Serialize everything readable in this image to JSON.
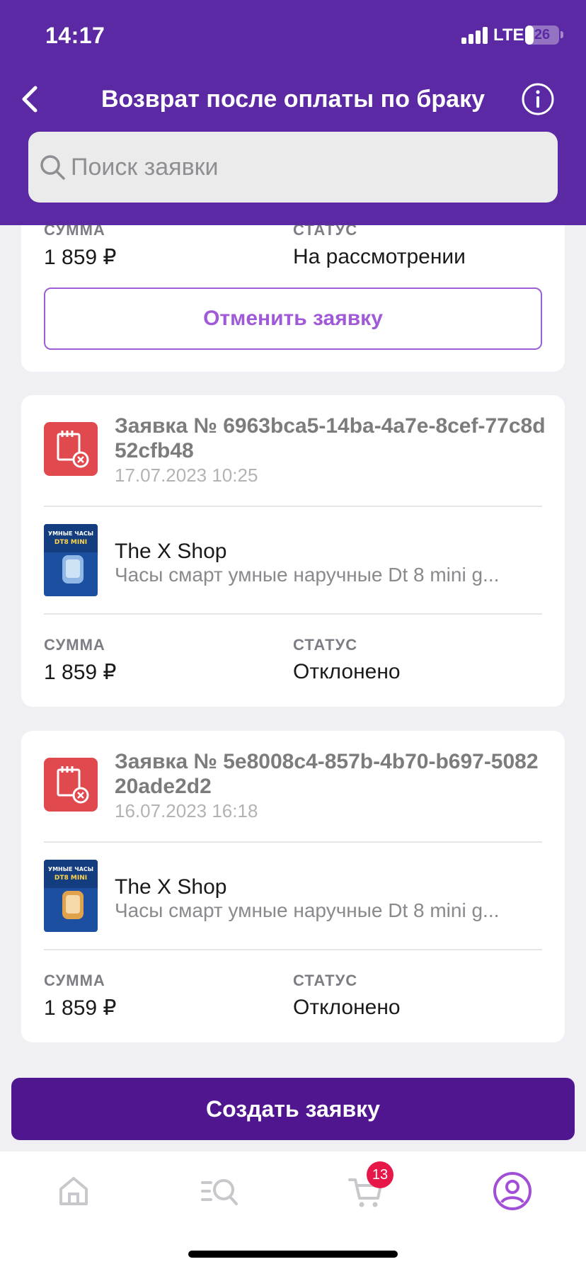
{
  "status_bar": {
    "time": "14:17",
    "network": "LTE",
    "battery": "26",
    "battery_fraction": 0.26
  },
  "header": {
    "title": "Возврат после оплаты по браку"
  },
  "search": {
    "placeholder": "Поиск заявки"
  },
  "labels": {
    "sum": "СУММА",
    "status": "СТАТУС"
  },
  "cards": [
    {
      "sum": "1 859 ₽",
      "status": "На рассмотрении",
      "cancel_label": "Отменить заявку"
    },
    {
      "title": "Заявка № 6963bca5-14ba-4a7e-8cef-77c8d52cfb48",
      "date": "17.07.2023 10:25",
      "shop": "The X Shop",
      "product": "Часы смарт умные наручные Dt 8 mini g...",
      "thumb_text": "УМНЫЕ ЧАСЫ DT8 MINI",
      "sum": "1 859 ₽",
      "status": "Отклонено"
    },
    {
      "title": "Заявка № 5e8008c4-857b-4b70-b697-508220ade2d2",
      "date": "16.07.2023 16:18",
      "shop": "The X Shop",
      "product": "Часы смарт умные наручные Dt 8 mini g...",
      "thumb_text": "УМНЫЕ ЧАСЫ DT8 MINI",
      "sum": "1 859 ₽",
      "status": "Отклонено"
    }
  ],
  "create_button": {
    "label": "Создать заявку"
  },
  "tabbar": {
    "cart_count": "13",
    "icons": [
      "home-icon",
      "catalog-search-icon",
      "cart-icon",
      "profile-icon"
    ]
  },
  "colors": {
    "header": "#5b29a3",
    "accent_button": "#4f1690",
    "cancel_outline": "#9b5ed6",
    "request_icon": "#e04a4f",
    "badge": "#e8174a",
    "profile_active": "#a14fd9"
  }
}
